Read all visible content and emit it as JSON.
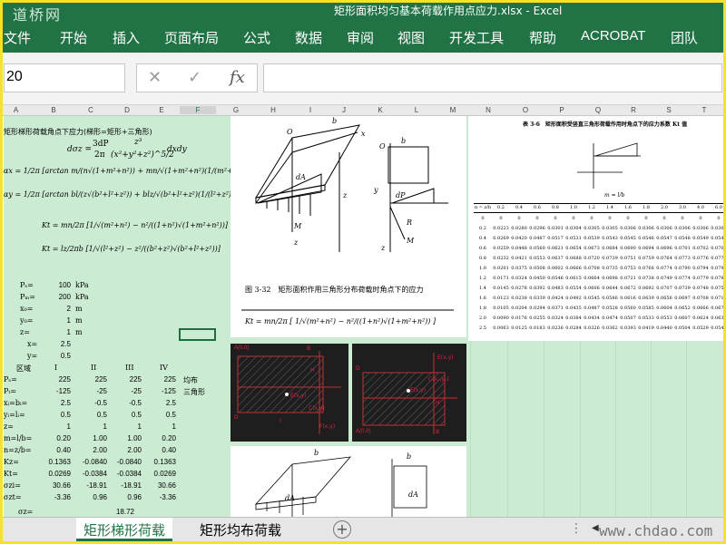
{
  "window": {
    "logo": "道桥网",
    "title": "矩形面积均匀基本荷载作用点应力.xlsx - Excel"
  },
  "ribbon": {
    "tabs": [
      "文件",
      "开始",
      "插入",
      "页面布局",
      "公式",
      "数据",
      "审阅",
      "视图",
      "开发工具",
      "帮助",
      "ACROBAT",
      "团队"
    ]
  },
  "formula_bar": {
    "name_box": "20",
    "cancel": "✕",
    "enter": "✓",
    "fx": "fx",
    "content": ""
  },
  "columns": [
    "A",
    "B",
    "C",
    "D",
    "E",
    "F",
    "G",
    "H",
    "I",
    "J",
    "K",
    "L",
    "M",
    "N",
    "O",
    "P",
    "Q",
    "R",
    "S",
    "T"
  ],
  "selected_column": "F",
  "sheet": {
    "heading": "矩形梯形荷载角点下应力(梯形=矩形+三角形)",
    "formula_dsz_lhs": "dσz =",
    "formula_dsz_num": "3dP",
    "formula_dsz_den": "2π",
    "formula_dsz_num2": "z³",
    "formula_dsz_den2": "(x²+y²+z²)^5/2",
    "formula_dsz_tail": "dxdy",
    "formula_ax": "αx = 1/2π [arctan m/(n√(1+m²+n²)) + mn/√(1+m²+n²)(1/(m²+n²)+1...)]",
    "formula_ay": "αy = 1/2π [arctan bl/(z√(b²+l²+z²)) + blz/√(b²+l²+z²)(1/(l²+z²)+1/(b²+...)]",
    "formula_kt": "Kt = mn/2π [1/√(m²+n²) − n²/((1+n²)√(1+m²+n²))]",
    "formula_kt2": "Kt = lz/2πb [1/√(l²+z²) − z²/((b²+z²)√(b²+l²+z²))]",
    "params": [
      {
        "label": "Pₛ=",
        "value": "100",
        "unit": "kPa"
      },
      {
        "label": "Pₘ=",
        "value": "200",
        "unit": "kPa"
      },
      {
        "label": "x₀=",
        "value": "2",
        "unit": "m"
      },
      {
        "label": "y₀=",
        "value": "1",
        "unit": "m"
      },
      {
        "label": "z=",
        "value": "1",
        "unit": "m"
      },
      {
        "label": "x=",
        "value": "2.5",
        "unit": ""
      },
      {
        "label": "y=",
        "value": "0.5",
        "unit": ""
      }
    ],
    "region_header": {
      "label": "区域",
      "cols": [
        "I",
        "II",
        "III",
        "IV"
      ]
    },
    "region_rows": [
      {
        "label": "Pₛ=",
        "values": [
          "225",
          "225",
          "225",
          "225"
        ],
        "note": "均布"
      },
      {
        "label": "Pₜ=",
        "values": [
          "-125",
          "-25",
          "-25",
          "-125"
        ],
        "note": "三角形"
      },
      {
        "label": "xᵢ=bᵢ=",
        "values": [
          "2.5",
          "-0.5",
          "-0.5",
          "2.5"
        ],
        "note": ""
      },
      {
        "label": "yᵢ=lᵢ=",
        "values": [
          "0.5",
          "0.5",
          "0.5",
          "0.5"
        ],
        "note": ""
      },
      {
        "label": "z=",
        "values": [
          "1",
          "1",
          "1",
          "1"
        ],
        "note": ""
      },
      {
        "label": "m=l/b=",
        "values": [
          "0.20",
          "1.00",
          "1.00",
          "0.20"
        ],
        "note": ""
      },
      {
        "label": "n=z/b=",
        "values": [
          "0.40",
          "2.00",
          "2.00",
          "0.40"
        ],
        "note": ""
      },
      {
        "label": "Kz=",
        "values": [
          "0.1363",
          "-0.0840",
          "-0.0840",
          "0.1363"
        ],
        "note": ""
      },
      {
        "label": "Kt=",
        "values": [
          "0.0269",
          "-0.0384",
          "-0.0384",
          "0.0269"
        ],
        "note": ""
      },
      {
        "label": "σzi=",
        "values": [
          "30.66",
          "-18.91",
          "-18.91",
          "30.66"
        ],
        "note": ""
      },
      {
        "label": "σzt=",
        "values": [
          "-3.36",
          "0.96",
          "0.96",
          "-3.36"
        ],
        "note": ""
      }
    ],
    "sum_row": {
      "label": "σz=",
      "value": "18.72"
    }
  },
  "figures": {
    "fig332_caption": "图 3-32　矩形面积作用三角形分布荷载时角点下的应力",
    "fig332_formula": "Kt = mn/2π [ 1/√(m²+n²) − n²/((1+n²)√(1+m²+n²)) ]",
    "table36_title": "表 3-6　矩形面积受竖直三角形荷载作用时角点下的应力系数 Kt 值",
    "table36_mlabel": "m = l/b",
    "table36_header": [
      "n = z/b",
      "0.2",
      "0.4",
      "0.6",
      "0.8",
      "1.0",
      "1.2",
      "1.4",
      "1.6",
      "1.8",
      "2.0",
      "3.0",
      "4.0",
      "6.0"
    ],
    "table36_rows": [
      [
        "0",
        "0",
        "0",
        "0",
        "0",
        "0",
        "0",
        "0",
        "0",
        "0",
        "0",
        "0",
        "0",
        "0"
      ],
      [
        "0.2",
        "0.0223",
        "0.0280",
        "0.0296",
        "0.0301",
        "0.0304",
        "0.0305",
        "0.0305",
        "0.0306",
        "0.0306",
        "0.0306",
        "0.0306",
        "0.0306",
        "0.0306"
      ],
      [
        "0.4",
        "0.0269",
        "0.0420",
        "0.0487",
        "0.0517",
        "0.0531",
        "0.0539",
        "0.0543",
        "0.0545",
        "0.0546",
        "0.0547",
        "0.0548",
        "0.0549",
        "0.0549"
      ],
      [
        "0.6",
        "0.0259",
        "0.0448",
        "0.0560",
        "0.0621",
        "0.0654",
        "0.0673",
        "0.0684",
        "0.0690",
        "0.0694",
        "0.0696",
        "0.0701",
        "0.0702",
        "0.0702"
      ],
      [
        "0.8",
        "0.0232",
        "0.0421",
        "0.0553",
        "0.0637",
        "0.0688",
        "0.0720",
        "0.0739",
        "0.0751",
        "0.0759",
        "0.0764",
        "0.0773",
        "0.0776",
        "0.0776"
      ],
      [
        "1.0",
        "0.0201",
        "0.0375",
        "0.0508",
        "0.0602",
        "0.0666",
        "0.0708",
        "0.0735",
        "0.0753",
        "0.0766",
        "0.0774",
        "0.0790",
        "0.0794",
        "0.0795"
      ],
      [
        "1.2",
        "0.0171",
        "0.0324",
        "0.0450",
        "0.0546",
        "0.0615",
        "0.0664",
        "0.0698",
        "0.0721",
        "0.0738",
        "0.0749",
        "0.0774",
        "0.0779",
        "0.0782"
      ],
      [
        "1.4",
        "0.0145",
        "0.0278",
        "0.0392",
        "0.0483",
        "0.0554",
        "0.0606",
        "0.0644",
        "0.0672",
        "0.0692",
        "0.0707",
        "0.0739",
        "0.0748",
        "0.0752"
      ],
      [
        "1.6",
        "0.0123",
        "0.0238",
        "0.0339",
        "0.0424",
        "0.0492",
        "0.0545",
        "0.0586",
        "0.0616",
        "0.0639",
        "0.0656",
        "0.0697",
        "0.0708",
        "0.0714"
      ],
      [
        "1.8",
        "0.0105",
        "0.0204",
        "0.0294",
        "0.0371",
        "0.0435",
        "0.0487",
        "0.0528",
        "0.0560",
        "0.0585",
        "0.0604",
        "0.0652",
        "0.0666",
        "0.0673"
      ],
      [
        "2.0",
        "0.0090",
        "0.0176",
        "0.0255",
        "0.0324",
        "0.0384",
        "0.0434",
        "0.0474",
        "0.0507",
        "0.0533",
        "0.0553",
        "0.0607",
        "0.0624",
        "0.0634"
      ],
      [
        "2.5",
        "0.0063",
        "0.0125",
        "0.0183",
        "0.0236",
        "0.0284",
        "0.0326",
        "0.0362",
        "0.0393",
        "0.0419",
        "0.0440",
        "0.0504",
        "0.0529",
        "0.0543"
      ]
    ],
    "dark1_labels": {
      "a": "A(0,0)",
      "b": "B",
      "e": "E(x,y)",
      "c": "C(x,y)",
      "d": "D",
      "f": "F(x,y)",
      "h": "H",
      "i": "I"
    },
    "dark2_labels": {
      "a": "A(0,0)",
      "b": "B",
      "e": "E(x,y)",
      "c": "C(xₙ,yₙ)",
      "d": "D",
      "f": "F(x,y)",
      "h": "H"
    }
  },
  "sheet_tabs": [
    "矩形梯形荷载",
    "矩形均布荷载"
  ],
  "active_sheet_tab": 0,
  "add_sheet": "+",
  "more": "⋮",
  "scroll_arrow": "◀",
  "watermark": "www.chdao.com"
}
